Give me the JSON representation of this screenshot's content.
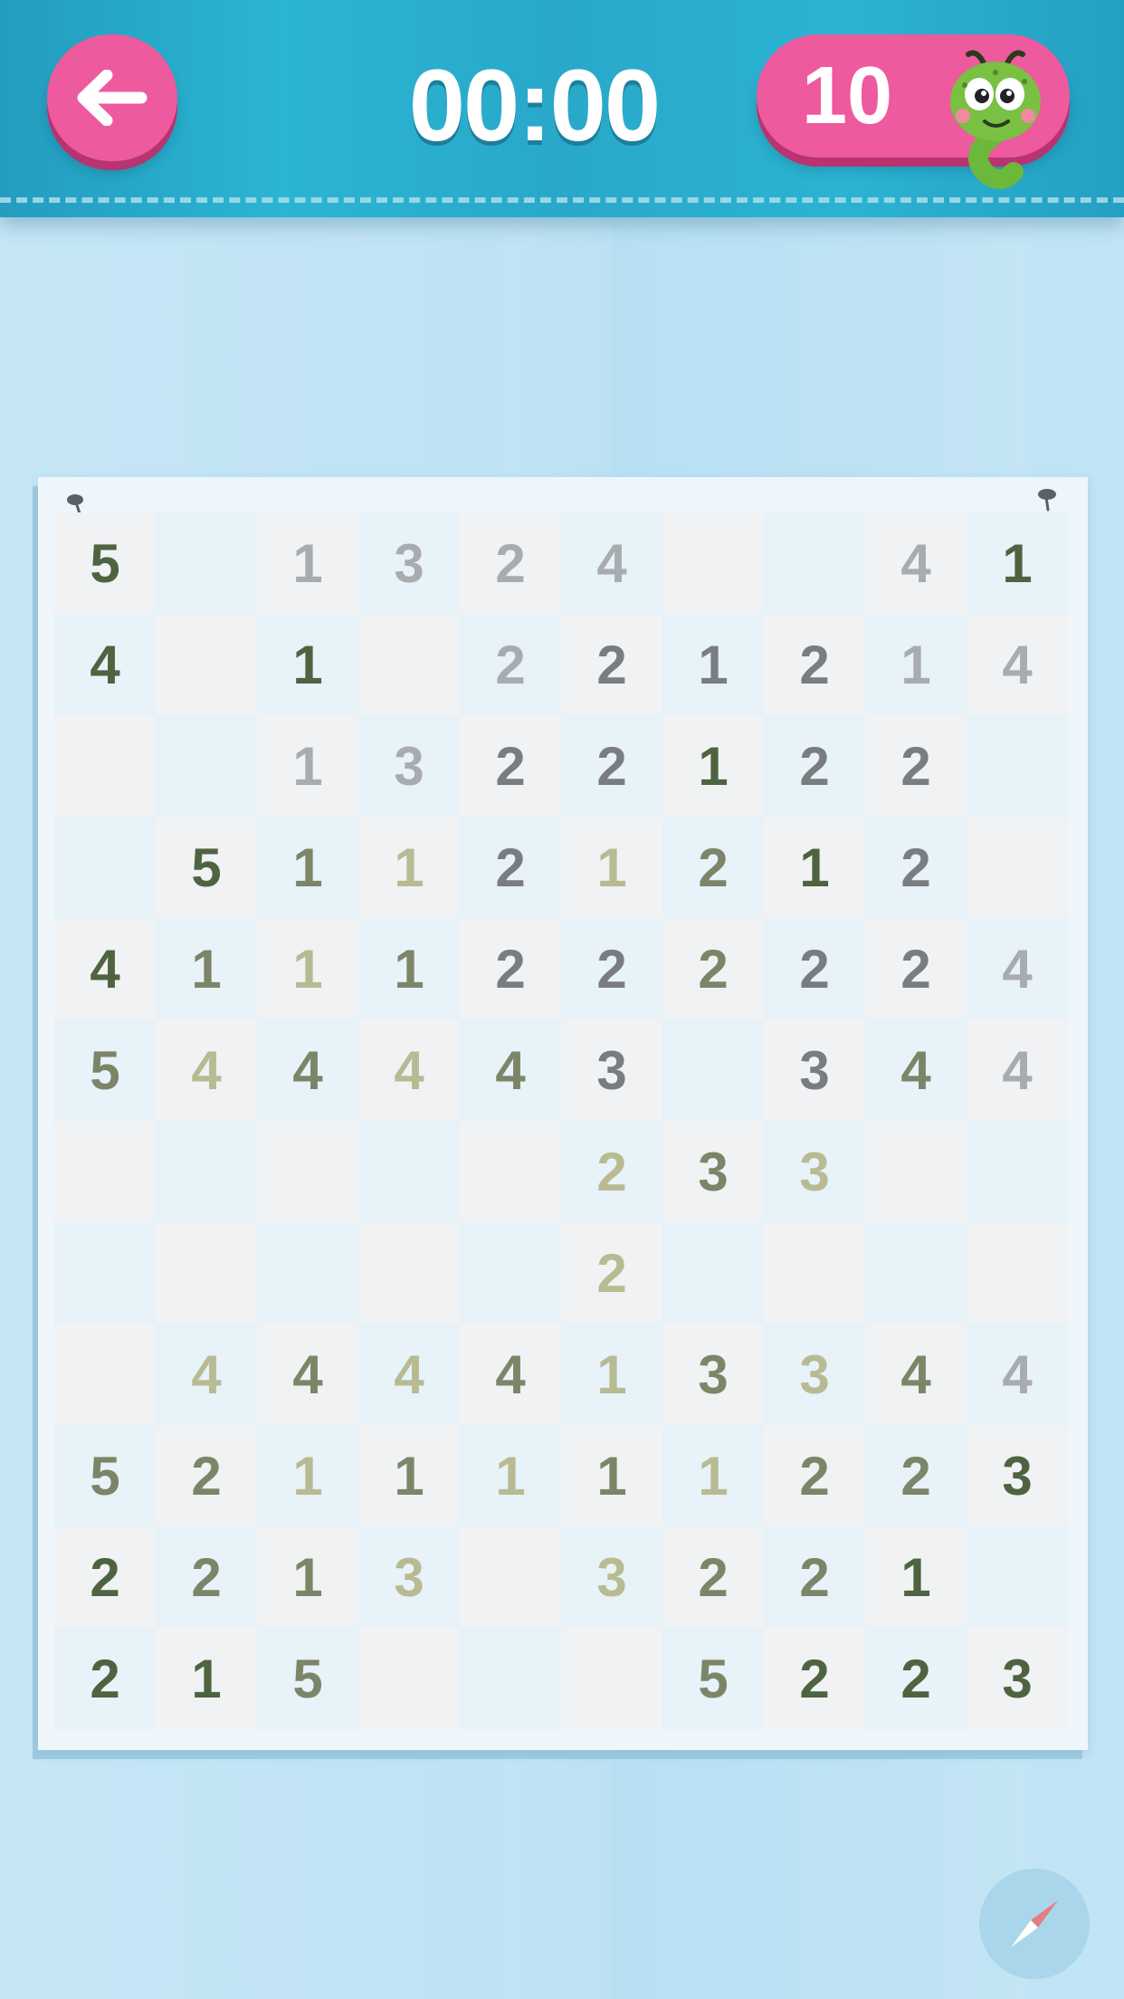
{
  "header": {
    "timer": "00:00",
    "moves": "10",
    "back_icon": "arrow-left-icon",
    "mascot_icon": "green-caterpillar-mascot"
  },
  "colors": {
    "header": "#29a8ca",
    "pink_button": "#ed5a9e",
    "background": "#bfe3f4",
    "board": "#eef6fb",
    "tile_grey": "#f0f2f4",
    "tile_blue": "#e7f2f9",
    "digit_palette": {
      "D": "#4e6440",
      "M": "#7c8568",
      "L": "#b8bb92",
      "S": "#7a7d80",
      "G": "#a9acaf"
    }
  },
  "board": {
    "rows": 12,
    "cols": 10,
    "cells": [
      [
        {
          "v": "5",
          "c": "D"
        },
        {
          "v": "",
          "c": ""
        },
        {
          "v": "1",
          "c": "G"
        },
        {
          "v": "3",
          "c": "G"
        },
        {
          "v": "2",
          "c": "G"
        },
        {
          "v": "4",
          "c": "G"
        },
        {
          "v": "",
          "c": ""
        },
        {
          "v": "",
          "c": ""
        },
        {
          "v": "4",
          "c": "G"
        },
        {
          "v": "1",
          "c": "D"
        }
      ],
      [
        {
          "v": "4",
          "c": "D"
        },
        {
          "v": "",
          "c": ""
        },
        {
          "v": "1",
          "c": "D"
        },
        {
          "v": "",
          "c": ""
        },
        {
          "v": "2",
          "c": "G"
        },
        {
          "v": "2",
          "c": "S"
        },
        {
          "v": "1",
          "c": "S"
        },
        {
          "v": "2",
          "c": "S"
        },
        {
          "v": "1",
          "c": "G"
        },
        {
          "v": "4",
          "c": "G"
        }
      ],
      [
        {
          "v": "",
          "c": ""
        },
        {
          "v": "",
          "c": ""
        },
        {
          "v": "1",
          "c": "G"
        },
        {
          "v": "3",
          "c": "G"
        },
        {
          "v": "2",
          "c": "S"
        },
        {
          "v": "2",
          "c": "S"
        },
        {
          "v": "1",
          "c": "D"
        },
        {
          "v": "2",
          "c": "S"
        },
        {
          "v": "2",
          "c": "S"
        },
        {
          "v": "",
          "c": ""
        }
      ],
      [
        {
          "v": "",
          "c": ""
        },
        {
          "v": "5",
          "c": "D"
        },
        {
          "v": "1",
          "c": "M"
        },
        {
          "v": "1",
          "c": "L"
        },
        {
          "v": "2",
          "c": "S"
        },
        {
          "v": "1",
          "c": "L"
        },
        {
          "v": "2",
          "c": "M"
        },
        {
          "v": "1",
          "c": "D"
        },
        {
          "v": "2",
          "c": "S"
        },
        {
          "v": "",
          "c": ""
        }
      ],
      [
        {
          "v": "4",
          "c": "D"
        },
        {
          "v": "1",
          "c": "M"
        },
        {
          "v": "1",
          "c": "L"
        },
        {
          "v": "1",
          "c": "M"
        },
        {
          "v": "2",
          "c": "S"
        },
        {
          "v": "2",
          "c": "S"
        },
        {
          "v": "2",
          "c": "M"
        },
        {
          "v": "2",
          "c": "S"
        },
        {
          "v": "2",
          "c": "S"
        },
        {
          "v": "4",
          "c": "G"
        }
      ],
      [
        {
          "v": "5",
          "c": "M"
        },
        {
          "v": "4",
          "c": "L"
        },
        {
          "v": "4",
          "c": "M"
        },
        {
          "v": "4",
          "c": "L"
        },
        {
          "v": "4",
          "c": "M"
        },
        {
          "v": "3",
          "c": "S"
        },
        {
          "v": "",
          "c": ""
        },
        {
          "v": "3",
          "c": "S"
        },
        {
          "v": "4",
          "c": "M"
        },
        {
          "v": "4",
          "c": "G"
        }
      ],
      [
        {
          "v": "",
          "c": ""
        },
        {
          "v": "",
          "c": ""
        },
        {
          "v": "",
          "c": ""
        },
        {
          "v": "",
          "c": ""
        },
        {
          "v": "",
          "c": ""
        },
        {
          "v": "2",
          "c": "L"
        },
        {
          "v": "3",
          "c": "M"
        },
        {
          "v": "3",
          "c": "L"
        },
        {
          "v": "",
          "c": ""
        },
        {
          "v": "",
          "c": ""
        }
      ],
      [
        {
          "v": "",
          "c": ""
        },
        {
          "v": "",
          "c": ""
        },
        {
          "v": "",
          "c": ""
        },
        {
          "v": "",
          "c": ""
        },
        {
          "v": "",
          "c": ""
        },
        {
          "v": "2",
          "c": "L"
        },
        {
          "v": "",
          "c": ""
        },
        {
          "v": "",
          "c": ""
        },
        {
          "v": "",
          "c": ""
        },
        {
          "v": "",
          "c": ""
        }
      ],
      [
        {
          "v": "",
          "c": ""
        },
        {
          "v": "4",
          "c": "L"
        },
        {
          "v": "4",
          "c": "M"
        },
        {
          "v": "4",
          "c": "L"
        },
        {
          "v": "4",
          "c": "M"
        },
        {
          "v": "1",
          "c": "L"
        },
        {
          "v": "3",
          "c": "M"
        },
        {
          "v": "3",
          "c": "L"
        },
        {
          "v": "4",
          "c": "M"
        },
        {
          "v": "4",
          "c": "G"
        }
      ],
      [
        {
          "v": "5",
          "c": "M"
        },
        {
          "v": "2",
          "c": "M"
        },
        {
          "v": "1",
          "c": "L"
        },
        {
          "v": "1",
          "c": "M"
        },
        {
          "v": "1",
          "c": "L"
        },
        {
          "v": "1",
          "c": "M"
        },
        {
          "v": "1",
          "c": "L"
        },
        {
          "v": "2",
          "c": "M"
        },
        {
          "v": "2",
          "c": "M"
        },
        {
          "v": "3",
          "c": "D"
        }
      ],
      [
        {
          "v": "2",
          "c": "D"
        },
        {
          "v": "2",
          "c": "M"
        },
        {
          "v": "1",
          "c": "M"
        },
        {
          "v": "3",
          "c": "L"
        },
        {
          "v": "",
          "c": ""
        },
        {
          "v": "3",
          "c": "L"
        },
        {
          "v": "2",
          "c": "M"
        },
        {
          "v": "2",
          "c": "M"
        },
        {
          "v": "1",
          "c": "D"
        },
        {
          "v": "",
          "c": ""
        }
      ],
      [
        {
          "v": "2",
          "c": "D"
        },
        {
          "v": "1",
          "c": "D"
        },
        {
          "v": "5",
          "c": "M"
        },
        {
          "v": "",
          "c": ""
        },
        {
          "v": "",
          "c": ""
        },
        {
          "v": "",
          "c": ""
        },
        {
          "v": "5",
          "c": "M"
        },
        {
          "v": "2",
          "c": "D"
        },
        {
          "v": "2",
          "c": "D"
        },
        {
          "v": "3",
          "c": "D"
        }
      ]
    ]
  },
  "footer": {
    "hint_icon": "compass-icon"
  }
}
